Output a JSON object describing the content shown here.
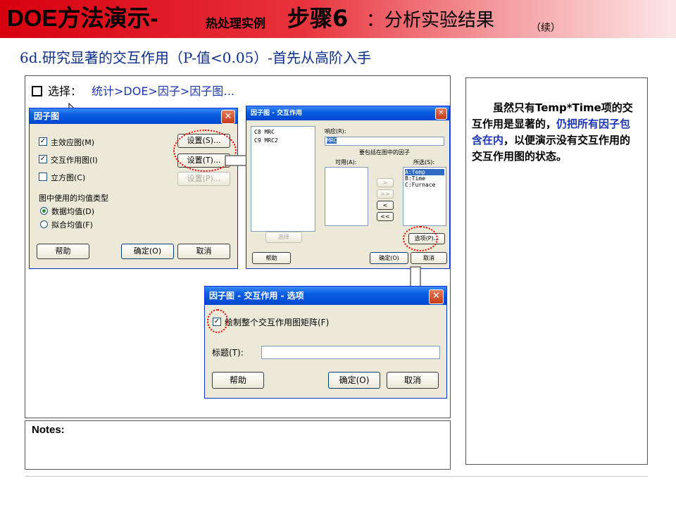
{
  "slide": {
    "title_main": "DOE方法演示-",
    "title_small": "热处理实例",
    "title_step": "步骤6",
    "title_colon": "：分析实验结果",
    "title_cont": "（续）",
    "subtitle": "6d.研究显著的交互作用（P-值<0.05）-首先从高阶入手",
    "menu_prefix": "选择：",
    "menu_path": "统计>DOE>因子>因子图…",
    "notes_label": "Notes:",
    "side_note_part1": "虽然只有Temp*Time项的交互作用是显著的，",
    "side_note_highlight": "仍把所有因子包含在内",
    "side_note_part2": "，以便演示没有交互作用的交互作用图的状态。"
  },
  "dialog_factorial": {
    "title": "因子图",
    "close": "✕",
    "main_effects_label": "主效应图(M)",
    "interaction_label": "交互作用图(I)",
    "cube_label": "立方图(C)",
    "setup1": "设置(S)...",
    "setup2": "设置(T)...",
    "setup3": "设置(P)...",
    "mean_type_label": "图中使用的均值类型",
    "data_means": "数据均值(D)",
    "fitted_means": "拟合均值(F)",
    "help": "帮助",
    "ok": "确定(O)",
    "cancel": "取消",
    "checked": "✓"
  },
  "dialog_interaction": {
    "title": "因子图 - 交互作用",
    "close": "✕",
    "cols": [
      "C8  MRC",
      "C9  MRC2"
    ],
    "response_label": "响应(R):",
    "response_value": "MRC",
    "include_label": "要包括在图中的因子",
    "available_label": "可用(A):",
    "selected_label": "所选(S):",
    "selected": [
      "A:Temp",
      "B:Time",
      "C:Furnace"
    ],
    "move_btns": [
      ">",
      ">>",
      "<",
      "<<"
    ],
    "select_btn": "选择",
    "options_btn": "选项(P)...",
    "help": "帮助",
    "ok": "确定(O)",
    "cancel": "取消"
  },
  "dialog_options": {
    "title": "因子图 - 交互作用 - 选项",
    "close": "✕",
    "matrix_label": "绘制整个交互作用图矩阵(F)",
    "title_label": "标题(T):",
    "title_value": "",
    "help": "帮助",
    "ok": "确定(O)",
    "cancel": "取消",
    "checked": "✓"
  },
  "colors": {
    "title_gradient_start": "#d7000f",
    "subtitle_blue": "#0d2f8c",
    "xp_title_blue": "#0046d1",
    "highlight_red": "#e00000"
  }
}
